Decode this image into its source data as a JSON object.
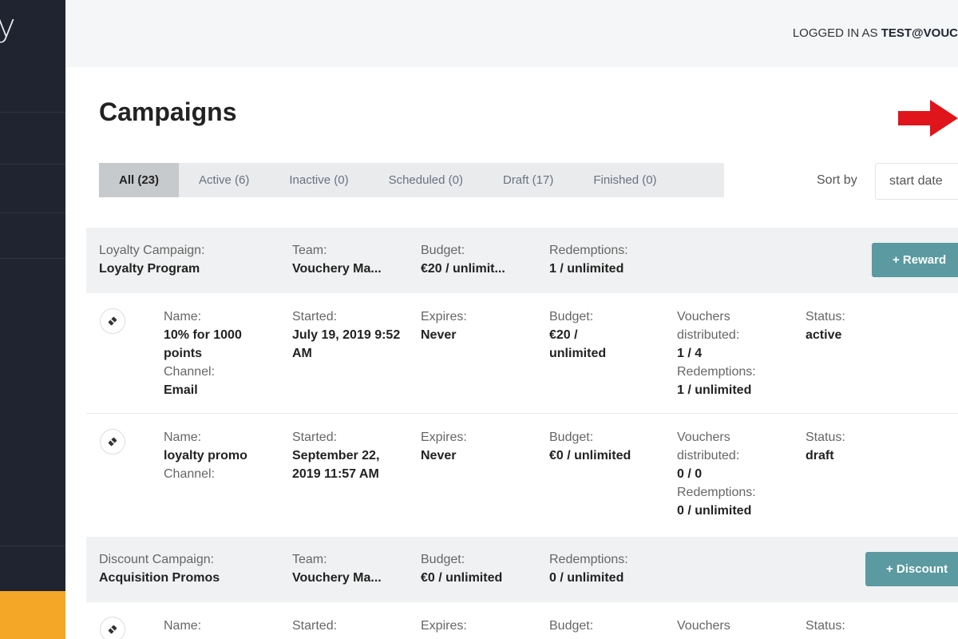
{
  "sidebar": {
    "logo_text": "y"
  },
  "header": {
    "login_prefix": "LOGGED IN AS ",
    "login_user": "TEST@VOUC"
  },
  "page": {
    "title": "Campaigns"
  },
  "tabs": [
    {
      "label": "All (23)"
    },
    {
      "label": "Active (6)"
    },
    {
      "label": "Inactive (0)"
    },
    {
      "label": "Scheduled (0)"
    },
    {
      "label": "Draft (17)"
    },
    {
      "label": "Finished (0)"
    }
  ],
  "sort": {
    "label": "Sort by",
    "value": "start date"
  },
  "groups": [
    {
      "type_label": "Loyalty Campaign:",
      "name": "Loyalty Program",
      "team_label": "Team:",
      "team": "Vouchery Ma...",
      "budget_label": "Budget:",
      "budget": "€20 / unlimit...",
      "redemptions_label": "Redemptions:",
      "redemptions": "1 / unlimited",
      "action": "+ Reward",
      "rows": [
        {
          "icon": "tag-icon",
          "name_label": "Name:",
          "name": "10% for 1000 points",
          "channel_label": "Channel:",
          "channel": "Email",
          "started_label": "Started:",
          "started": "July 19, 2019 9:52 AM",
          "expires_label": "Expires:",
          "expires": "Never",
          "budget_label": "Budget:",
          "budget": "€20 / unlimited",
          "vouchers_label": "Vouchers distributed:",
          "vouchers": "1 / 4",
          "redemptions_label": "Redemptions:",
          "redemptions": "1 / unlimited",
          "status_label": "Status:",
          "status": "active"
        },
        {
          "icon": "tag-icon",
          "name_label": "Name:",
          "name": "loyalty promo",
          "channel_label": "Channel:",
          "channel": "",
          "started_label": "Started:",
          "started": "September 22, 2019 11:57 AM",
          "expires_label": "Expires:",
          "expires": "Never",
          "budget_label": "Budget:",
          "budget": "€0 / unlimited",
          "vouchers_label": "Vouchers distributed:",
          "vouchers": "0 / 0",
          "redemptions_label": "Redemptions:",
          "redemptions": "0 / unlimited",
          "status_label": "Status:",
          "status": "draft"
        }
      ]
    },
    {
      "type_label": "Discount Campaign:",
      "name": "Acquisition Promos",
      "team_label": "Team:",
      "team": "Vouchery Ma...",
      "budget_label": "Budget:",
      "budget": "€0 / unlimited",
      "redemptions_label": "Redemptions:",
      "redemptions": "0 / unlimited",
      "action": "+ Discount",
      "rows": [
        {
          "icon": "tag-icon",
          "name_label": "Name:",
          "started_label": "Started:",
          "expires_label": "Expires:",
          "budget_label": "Budget:",
          "vouchers_label": "Vouchers",
          "status_label": "Status:"
        }
      ]
    }
  ],
  "colors": {
    "sidebar": "#1f2430",
    "accent": "#f4a726",
    "button": "#5a9aa0",
    "arrow": "#e0141b"
  }
}
